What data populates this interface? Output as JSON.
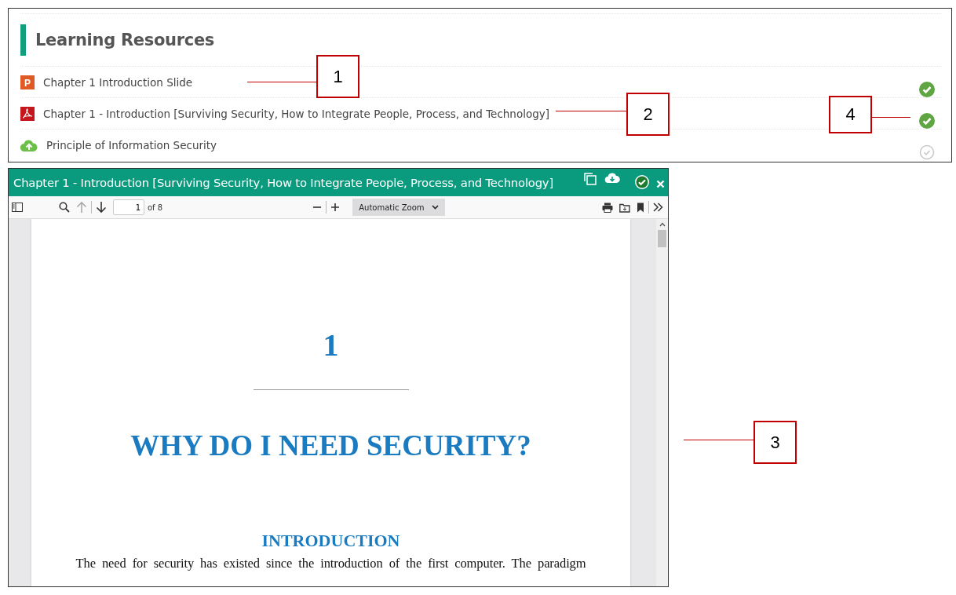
{
  "resources": {
    "title": "Learning Resources",
    "items": [
      {
        "kind": "slide",
        "icon_text": "P",
        "label": "Chapter 1 Introduction Slide",
        "completed": true
      },
      {
        "kind": "pdf",
        "label": "Chapter 1 - Introduction [Surviving Security, How to Integrate People, Process, and Technology]",
        "completed": true
      },
      {
        "kind": "upload",
        "label": "Principle of Information Security",
        "completed": false
      }
    ]
  },
  "viewer": {
    "title": "Chapter 1 - Introduction [Surviving Security, How to Integrate People, Process, and Technology]",
    "toolbar": {
      "page": "1",
      "page_count": "of 8",
      "zoom": "Automatic Zoom"
    },
    "document": {
      "chapter_number": "1",
      "chapter_title": "WHY DO I NEED SECURITY?",
      "section_heading": "INTRODUCTION",
      "paragraph": "The need for security has existed since the introduction of the first computer. The paradigm"
    }
  },
  "callouts": [
    {
      "label": "1"
    },
    {
      "label": "2"
    },
    {
      "label": "3"
    },
    {
      "label": "4"
    }
  ]
}
